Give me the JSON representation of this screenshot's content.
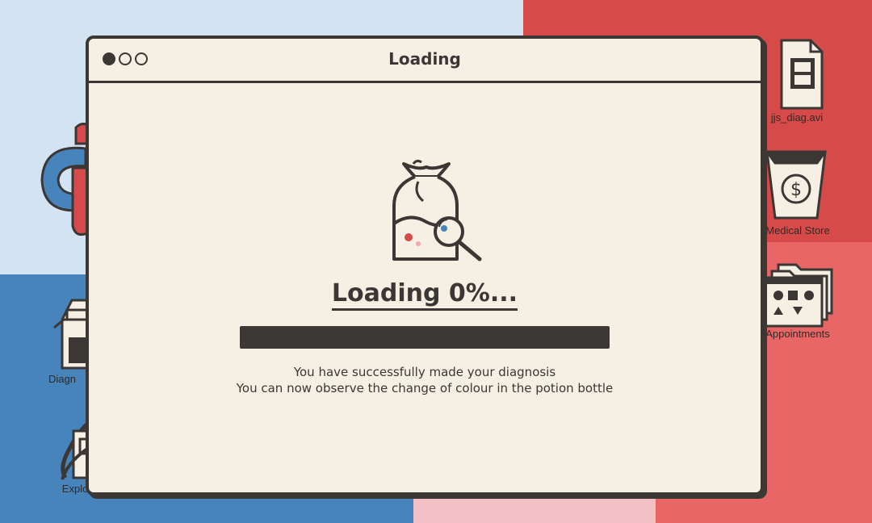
{
  "window": {
    "title": "Loading"
  },
  "loading": {
    "heading": "Loading 0%...",
    "progress_percent": 0,
    "message_line1": "You have successfully made your diagnosis",
    "message_line2": "You can now observe the change of colour in the potion bottle"
  },
  "desktop": {
    "icons": [
      {
        "label": "jjs_diag.avi",
        "icon": "video-file-icon"
      },
      {
        "label": "Medical Store",
        "icon": "shopping-bag-dollar-icon"
      },
      {
        "label": "Appointments",
        "icon": "folder-shapes-icon"
      },
      {
        "label": "Diagn",
        "icon": "bottle-folder-icon"
      },
      {
        "label": "Explorer",
        "icon": "explorer-icon"
      }
    ]
  },
  "colors": {
    "window_bg": "#f6efe4",
    "outline": "#3a3734",
    "progress_track": "#3b3836",
    "bg_light_blue": "#d3e3f2",
    "bg_blue": "#4784bb",
    "bg_red": "#d74a4a",
    "bg_salmon": "#e86666",
    "bg_pink": "#f2c1c5"
  }
}
